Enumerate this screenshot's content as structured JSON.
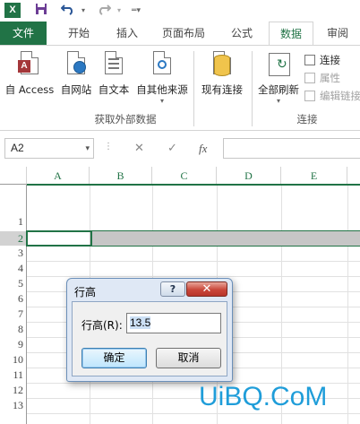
{
  "app": {
    "logo_text": "X",
    "colors": {
      "accent": "#217346",
      "selection_gray": "#c6c6c6",
      "watermark": "#1f9dd9"
    }
  },
  "qat": {
    "save_icon": "save-icon",
    "undo_icon": "undo-icon",
    "redo_icon": "redo-icon",
    "customize_icon": "customize-icon"
  },
  "tabs": [
    {
      "label": "文件"
    },
    {
      "label": "开始"
    },
    {
      "label": "插入"
    },
    {
      "label": "页面布局"
    },
    {
      "label": "公式"
    },
    {
      "label": "数据"
    },
    {
      "label": "审阅"
    }
  ],
  "ribbon": {
    "get_external": {
      "buttons": [
        {
          "label": "自 Access",
          "icon": "access-icon"
        },
        {
          "label": "自网站",
          "icon": "web-icon"
        },
        {
          "label": "自文本",
          "icon": "text-file-icon"
        },
        {
          "label": "自其他来源",
          "icon": "other-sources-icon",
          "dropdown": "▾"
        },
        {
          "label": "现有连接",
          "icon": "existing-connections-icon"
        }
      ],
      "group_label": "获取外部数据"
    },
    "connections": {
      "refresh_all": {
        "label": "全部刷新",
        "dropdown": "▾"
      },
      "small": [
        {
          "label": "连接",
          "enabled": true
        },
        {
          "label": "属性",
          "enabled": false
        },
        {
          "label": "编辑链接",
          "enabled": false
        }
      ],
      "group_label": "连接"
    }
  },
  "formula_bar": {
    "name_box": "A2",
    "dropdown": "▾",
    "cancel": "✕",
    "enter": "✓",
    "fx": "fx",
    "value": ""
  },
  "grid": {
    "columns": [
      "A",
      "B",
      "C",
      "D",
      "E"
    ],
    "rows": [
      "1",
      "2",
      "3",
      "4",
      "5",
      "6",
      "7",
      "8",
      "9",
      "10",
      "11",
      "12",
      "13"
    ],
    "selected_row": "2",
    "selected_cell": "A2"
  },
  "dialog": {
    "title": "行高",
    "help": "?",
    "close": "✕",
    "label": "行高(R):",
    "value": "13.5",
    "ok": "确定",
    "cancel": "取消"
  },
  "watermark": "UiBQ.CoM"
}
